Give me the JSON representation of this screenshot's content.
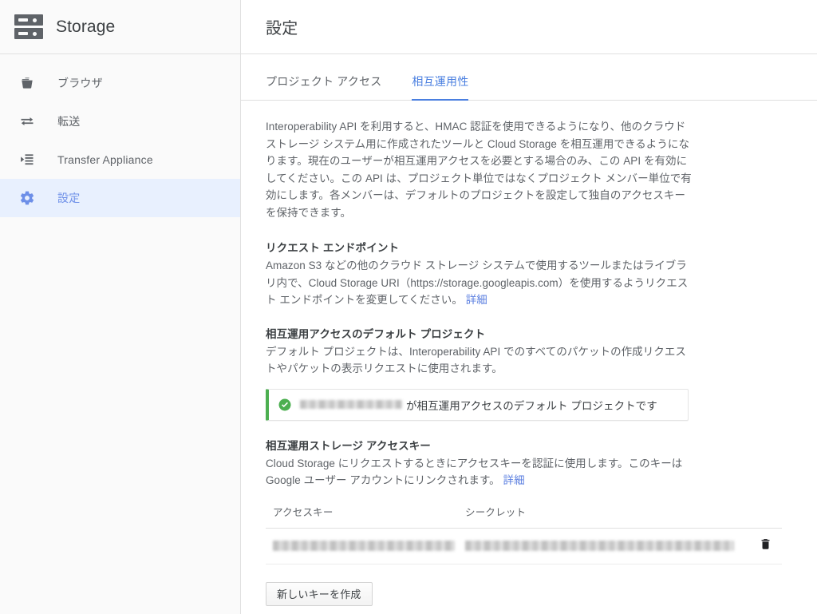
{
  "sidebar": {
    "product_title": "Storage",
    "product_icon": "storage-servers-icon",
    "items": [
      {
        "label": "ブラウザ",
        "icon": "bucket-icon",
        "active": false
      },
      {
        "label": "転送",
        "icon": "transfer-arrows-icon",
        "active": false
      },
      {
        "label": "Transfer Appliance",
        "icon": "transfer-appliance-icon",
        "active": false
      },
      {
        "label": "設定",
        "icon": "gear-icon",
        "active": true
      }
    ]
  },
  "header": {
    "title": "設定"
  },
  "tabs": [
    {
      "label": "プロジェクト アクセス",
      "active": false
    },
    {
      "label": "相互運用性",
      "active": true
    }
  ],
  "intro": {
    "paragraph": "Interoperability API を利用すると、HMAC 認証を使用できるようになり、他のクラウド ストレージ システム用に作成されたツールと Cloud Storage を相互運用できるようになります。現在のユーザーが相互運用アクセスを必要とする場合のみ、この API を有効にしてください。この API は、プロジェクト単位ではなくプロジェクト メンバー単位で有効にします。各メンバーは、デフォルトのプロジェクトを設定して独自のアクセスキーを保持できます。"
  },
  "request_endpoint": {
    "heading": "リクエスト エンドポイント",
    "body": "Amazon S3 などの他のクラウド ストレージ システムで使用するツールまたはライブラリ内で、Cloud Storage URI（https://storage.googleapis.com）を使用するようリクエスト エンドポイントを変更してください。",
    "link_label": "詳細"
  },
  "default_project": {
    "heading": "相互運用アクセスのデフォルト プロジェクト",
    "body": "デフォルト プロジェクトは、Interoperability API でのすべてのパケットの作成リクエストやパケットの表示リクエストに使用されます。",
    "banner": {
      "icon": "check-circle-icon",
      "project_name_redacted": true,
      "text_suffix": "が相互運用アクセスのデフォルト プロジェクトです",
      "accent_color": "#4caf50"
    }
  },
  "access_keys": {
    "heading": "相互運用ストレージ アクセスキー",
    "body": "Cloud Storage にリクエストするときにアクセスキーを認証に使用します。このキーは Google ユーザー アカウントにリンクされます。",
    "link_label": "詳細",
    "table": {
      "columns": [
        "アクセスキー",
        "シークレット",
        ""
      ],
      "rows": [
        {
          "access_key": "",
          "secret": "",
          "access_key_redacted": true,
          "secret_redacted": true,
          "delete_icon": "trash-icon"
        }
      ]
    },
    "create_button_label": "新しいキーを作成"
  },
  "colors": {
    "accent_blue": "#4a7fe0",
    "active_nav_bg": "#e8f0fe",
    "active_nav_fg": "#6d8fe8",
    "link": "#5b7fe0",
    "success_green": "#4caf50",
    "text_primary": "#3c4043",
    "text_secondary": "#5f6368",
    "sidebar_bg": "#fafafa",
    "divider": "#e0e0e0"
  }
}
